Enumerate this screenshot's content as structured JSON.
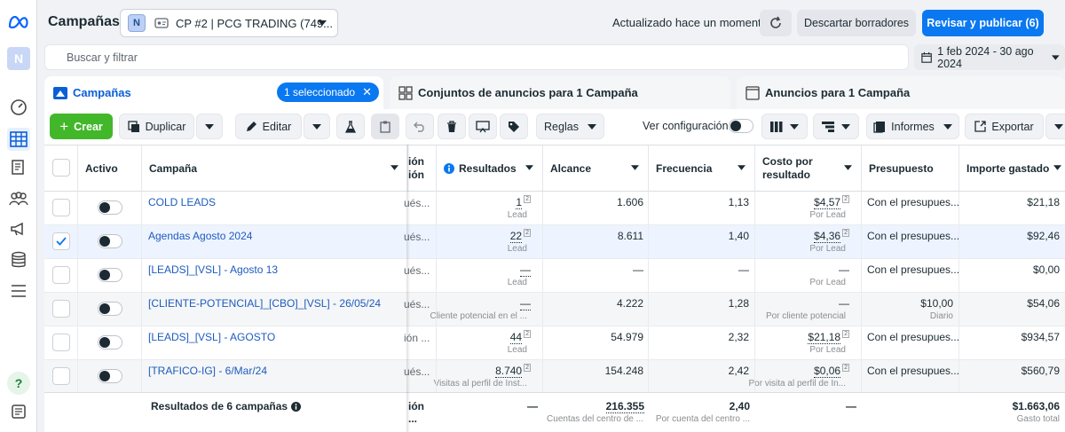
{
  "header": {
    "title": "Campañas",
    "account_badge": "N",
    "account_name": "CP #2 | PCG TRADING (749...",
    "updated": "Actualizado hace un momento",
    "discard": "Descartar borradores",
    "publish": "Revisar y publicar (6)"
  },
  "rail": {
    "avatar": "N",
    "help": "?"
  },
  "search": {
    "placeholder": "Buscar y filtrar"
  },
  "date_range": "1 feb 2024 - 30 ago 2024",
  "tabs": [
    {
      "label": "Campañas",
      "chip": "1 seleccionado"
    },
    {
      "label": "Conjuntos de anuncios para 1 Campaña"
    },
    {
      "label": "Anuncios para 1 Campaña"
    }
  ],
  "toolbar": {
    "create": "Crear",
    "duplicate": "Duplicar",
    "edit": "Editar",
    "rules": "Reglas",
    "view_config": "Ver configuración",
    "reports": "Informes",
    "export": "Exportar"
  },
  "columns": {
    "active": "Activo",
    "campaign": "Campaña",
    "clipped": "ión\nión",
    "results": "Resultados",
    "reach": "Alcance",
    "frequency": "Frecuencia",
    "cost_per_result": "Costo por resultado",
    "budget": "Presupuesto",
    "amount_spent": "Importe gastado"
  },
  "rows": [
    {
      "name": "COLD LEADS",
      "clip": "ués...",
      "results": "1",
      "results_sub": "Lead",
      "reach": "1.606",
      "frequency": "1,13",
      "cpr": "$4,57",
      "cpr_sub": "Por Lead",
      "budget": "Con el presupues...",
      "budget_sub": "",
      "spent": "$21,18",
      "checked": false
    },
    {
      "name": "Agendas Agosto 2024",
      "clip": "ués...",
      "results": "22",
      "results_sub": "Lead",
      "reach": "8.611",
      "frequency": "1,40",
      "cpr": "$4,36",
      "cpr_sub": "Por Lead",
      "budget": "Con el presupues...",
      "budget_sub": "",
      "spent": "$92,46",
      "checked": true
    },
    {
      "name": "[LEADS]_[VSL] - Agosto 13",
      "clip": "ués...",
      "results": "—",
      "results_sub": "Lead",
      "reach": "—",
      "frequency": "—",
      "cpr": "—",
      "cpr_sub": "Por Lead",
      "budget": "Con el presupues...",
      "budget_sub": "",
      "spent": "$0,00",
      "checked": false
    },
    {
      "name": "[CLIENTE-POTENCIAL]_[CBO]_[VSL] - 26/05/24",
      "clip": "ués...",
      "results": "—",
      "results_sub": "Cliente potencial en el ...",
      "reach": "4.222",
      "frequency": "1,28",
      "cpr": "—",
      "cpr_sub": "Por cliente potencial",
      "budget": "$10,00",
      "budget_sub": "Diario",
      "spent": "$54,06",
      "checked": false
    },
    {
      "name": "[LEADS]_[VSL] - AGOSTO",
      "clip": "ión ...",
      "results": "44",
      "results_sub": "Lead",
      "reach": "54.979",
      "frequency": "2,32",
      "cpr": "$21,18",
      "cpr_sub": "Por Lead",
      "budget": "Con el presupues...",
      "budget_sub": "",
      "spent": "$934,57",
      "checked": false
    },
    {
      "name": "[TRAFICO-IG] - 6/Mar/24",
      "clip": "ués...",
      "results": "8.740",
      "results_sub": "Visitas al perfil de Inst...",
      "reach": "154.248",
      "frequency": "2,42",
      "cpr": "$0,06",
      "cpr_sub": "Por visita al perfil de In...",
      "budget": "Con el presupues...",
      "budget_sub": "",
      "spent": "$560,79",
      "checked": false
    }
  ],
  "totals": {
    "label": "Resultados de 6 campañas",
    "clip": "ión ...",
    "results": "—",
    "reach": "216.355",
    "reach_sub": "Cuentas del centro de ...",
    "frequency": "2,40",
    "frequency_sub": "Por cuenta del centro ...",
    "cpr": "—",
    "spent": "$1.663,06",
    "spent_sub": "Gasto total"
  },
  "colors": {
    "primary": "#0a78f0",
    "create": "#42b72a",
    "link": "#1d5bbf"
  }
}
